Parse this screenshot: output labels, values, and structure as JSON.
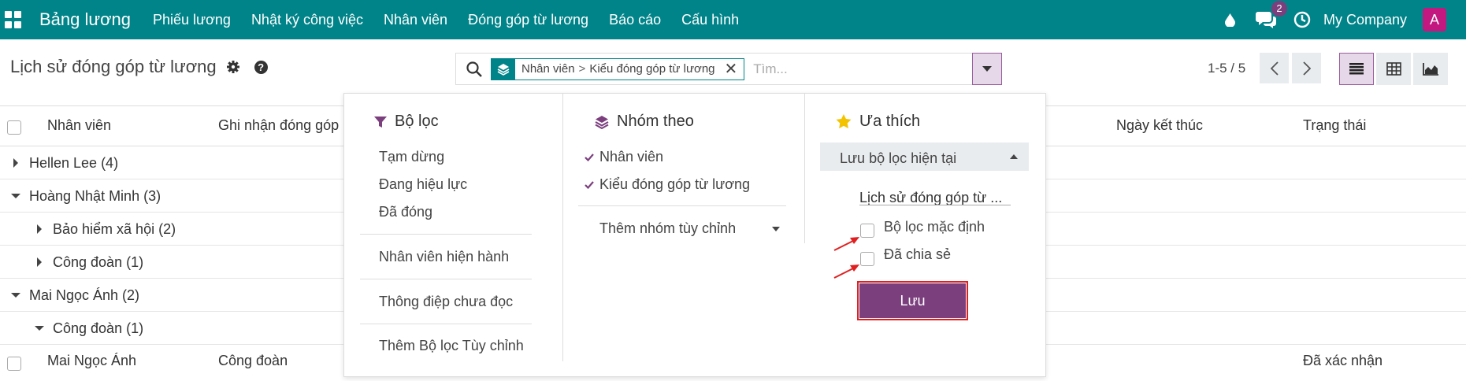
{
  "navbar": {
    "app_title": "Bảng lương",
    "menu": [
      "Phiếu lương",
      "Nhật ký công việc",
      "Nhân viên",
      "Đóng góp từ lương",
      "Báo cáo",
      "Cấu hình"
    ],
    "chat_badge": "2",
    "company": "My Company",
    "avatar_letter": "A",
    "colors": {
      "bar": "#018489",
      "avatar": "#c2187f",
      "badge": "#7b3f7e"
    }
  },
  "control": {
    "page_title": "Lịch sử đóng góp từ lương",
    "search": {
      "facet": [
        "Nhân viên",
        "Kiểu đóng góp từ lương"
      ],
      "facet_separator": ">",
      "facet_remove": "✕",
      "placeholder": "Tìm..."
    },
    "pager": "1-5 / 5"
  },
  "list": {
    "headers": [
      "Nhân viên",
      "Ghi nhận đóng góp",
      "Ngày kết thúc",
      "Trạng thái"
    ],
    "groups": [
      {
        "label": "Hellen Lee (4)",
        "expanded": false
      },
      {
        "label": "Hoàng Nhật Minh (3)",
        "expanded": true
      },
      {
        "label": "Bảo hiểm xã hội (2)",
        "expanded": false
      },
      {
        "label": "Công đoàn (1)",
        "expanded": false
      },
      {
        "label": "Mai Ngọc Ánh (2)",
        "expanded": true
      },
      {
        "label": "Công đoàn (1)",
        "expanded": true
      }
    ],
    "record": {
      "employee": "Mai Ngọc Ánh",
      "type": "Công đoàn",
      "status": "Đã xác nhận"
    }
  },
  "dropdown": {
    "filters": {
      "title": "Bộ lọc",
      "items": [
        "Tạm dừng",
        "Đang hiệu lực",
        "Đã đóng",
        "Nhân viên hiện hành",
        "Thông điệp chưa đọc",
        "Thêm Bộ lọc Tùy chỉnh"
      ]
    },
    "group_by": {
      "title": "Nhóm theo",
      "items": [
        "Nhân viên",
        "Kiểu đóng góp từ lương"
      ],
      "custom": "Thêm nhóm tùy chỉnh"
    },
    "favorites": {
      "title": "Ưa thích",
      "save_current": "Lưu bộ lọc hiện tại",
      "filter_name": "Lịch sử đóng góp từ ...",
      "default_label": "Bộ lọc mặc định",
      "shared_label": "Đã chia sẻ",
      "save_button": "Lưu"
    }
  }
}
